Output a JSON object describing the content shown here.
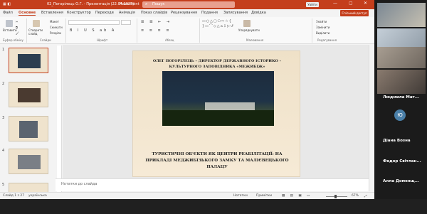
{
  "titlebar": {
    "filename": "02_Погорілець О.Г. - Презентація (22.04.2025)",
    "app": "PowerPoint",
    "search_placeholder": "Пошук",
    "sign_in": "Увійти"
  },
  "tabs": [
    "Файл",
    "Основне",
    "Вставлення",
    "Конструктор",
    "Переходи",
    "Анімація",
    "Показ слайдів",
    "Рецензування",
    "Подання",
    "Записування",
    "Довідка"
  ],
  "active_tab": "Основне",
  "share_label": "Спільний доступ",
  "ribbon": {
    "paste": "Вставити",
    "new_slide": "Створити слайд",
    "layout": "Макет",
    "reset": "Скинути",
    "sections": "Розділи",
    "arrange": "Упорядкувати",
    "find": "Знайти",
    "replace": "Замінити",
    "select": "Виділити",
    "groups": [
      "Буфер обміну",
      "Слайди",
      "Шрифт",
      "Абзац",
      "Малювання",
      "Редагування"
    ]
  },
  "slides": {
    "numbers": [
      "1",
      "2",
      "3",
      "4",
      "5"
    ],
    "selected": "1"
  },
  "current_slide": {
    "title": "ОЛЕГ ПОГОРІЛЕЦЬ – ДИРЕКТОР ДЕРЖАВНОГО ІСТОРИКО – КУЛЬТУРНОГО ЗАПОВІДНИКА «МЕЖИБІЖ»",
    "caption": "ТУРИСТИЧНІ ОБ'ЄКТИ ЯК ЦЕНТРИ РЕАБІЛІТАЦІЇ: НА ПРИКЛАДІ МЕДЖИБІЗЬКОГО ЗАМКУ ТА МАЛІЄВЕЦЬКОГО ПАЛАЦУ"
  },
  "notes_placeholder": "Нотатки до слайда",
  "status": {
    "slide_counter": "Слайд 1 з 27",
    "language": "українська",
    "notes_btn": "Нотатки",
    "comments_btn": "Примітки",
    "zoom": "67%"
  },
  "participants": [
    {
      "name": "Людмила Мат..."
    },
    {
      "name": "Діана Возна",
      "initial": "Ю"
    },
    {
      "name": "Федор Світлан..."
    },
    {
      "name": "Алла Доменщ..."
    }
  ],
  "colors": {
    "accent": "#c43e1c",
    "slide_bg": "#efe1c8",
    "video_bg": "#1b1b1b"
  }
}
